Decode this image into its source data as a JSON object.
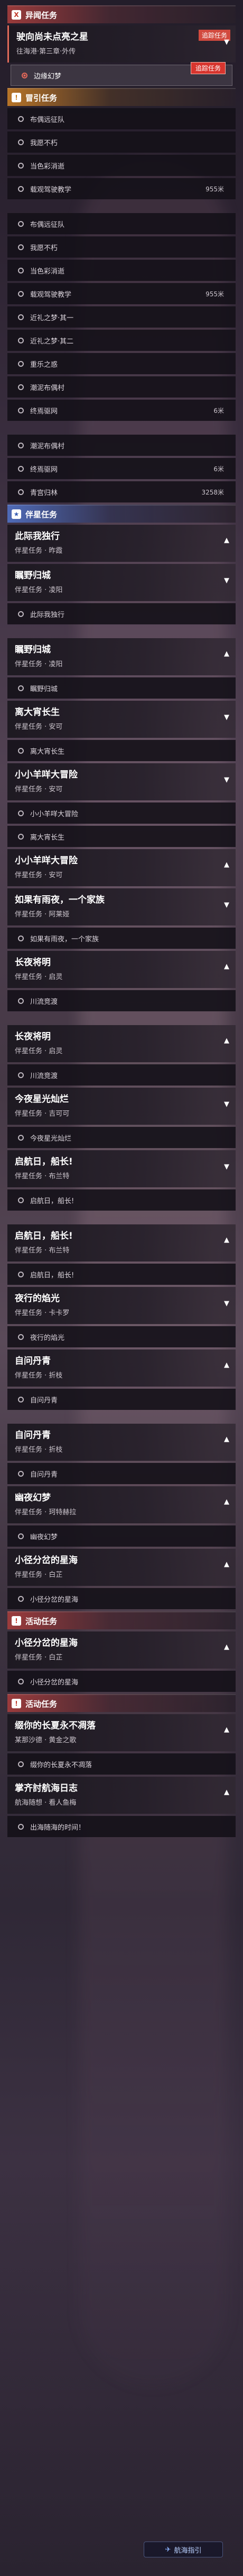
{
  "quest_list": {
    "sections": [
      {
        "kind": "trial",
        "title": "异闻任务",
        "icon": "X",
        "items": [
          {
            "type": "card",
            "title": "驶向尚未点亮之星",
            "sub": "往海港·第三章·外传",
            "arrow": "down",
            "active": true,
            "tag": "追踪任务"
          },
          {
            "type": "step",
            "text": "边缘幻梦",
            "active": true,
            "badge": "追踪任务"
          }
        ]
      },
      {
        "kind": "guide",
        "title": "冒引任务",
        "icon": "!",
        "items": [
          {
            "type": "step",
            "text": "布偶远征队"
          },
          {
            "type": "step",
            "text": "我愿不朽"
          },
          {
            "type": "step",
            "text": "当色彩消逝"
          },
          {
            "type": "step",
            "text": "载观驾驶教学",
            "dist": "955米"
          },
          {
            "type": "gap"
          },
          {
            "type": "step",
            "text": "布偶远征队"
          },
          {
            "type": "step",
            "text": "我愿不朽"
          },
          {
            "type": "step",
            "text": "当色彩消逝"
          },
          {
            "type": "step",
            "text": "载观驾驶教学",
            "dist": "955米"
          },
          {
            "type": "step",
            "text": "近礼之梦·其一"
          },
          {
            "type": "step",
            "text": "近礼之梦·其二"
          },
          {
            "type": "step",
            "text": "重乐之惑"
          },
          {
            "type": "step",
            "text": "潮泥布偶村"
          },
          {
            "type": "step",
            "text": "终焉驱网",
            "dist": "6米"
          },
          {
            "type": "gap"
          },
          {
            "type": "step",
            "text": "潮泥布偶村"
          },
          {
            "type": "step",
            "text": "终焉驱网",
            "dist": "6米"
          },
          {
            "type": "step",
            "text": "青宫归林",
            "dist": "3258米"
          }
        ]
      },
      {
        "kind": "comp",
        "title": "伴星任务",
        "icon": "★",
        "items": [
          {
            "type": "card",
            "title": "此际我独行",
            "sub": "伴星任务 · 昨霞",
            "arrow": "up"
          },
          {
            "type": "card",
            "title": "瞩野归城",
            "sub": "伴星任务 · 凌阳",
            "arrow": "down"
          },
          {
            "type": "step",
            "text": "此际我独行"
          },
          {
            "type": "gap"
          },
          {
            "type": "card",
            "title": "瞩野归城",
            "sub": "伴星任务 · 凌阳",
            "arrow": "up"
          },
          {
            "type": "step",
            "text": "瞩野归城"
          },
          {
            "type": "card",
            "title": "离大宵长生",
            "sub": "伴星任务 · 安可",
            "arrow": "down"
          },
          {
            "type": "step",
            "text": "离大宵长生"
          },
          {
            "type": "card",
            "title": "小小羊咩大冒险",
            "sub": "伴星任务 · 安可",
            "arrow": "down"
          },
          {
            "type": "step",
            "text": "小小羊咩大冒险"
          },
          {
            "type": "step",
            "text": "离大宵长生"
          },
          {
            "type": "card",
            "title": "小小羊咩大冒险",
            "sub": "伴星任务 · 安可",
            "arrow": "up"
          },
          {
            "type": "card",
            "title": "如果有雨夜，一个家族",
            "sub": "伴星任务 · 阿莱娅",
            "arrow": "down"
          },
          {
            "type": "step",
            "text": "如果有雨夜，一个家族"
          },
          {
            "type": "card",
            "title": "长夜将明",
            "sub": "伴星任务 · 启灵",
            "arrow": "up"
          },
          {
            "type": "step",
            "text": "川流竞渡"
          },
          {
            "type": "gap"
          },
          {
            "type": "card",
            "title": "长夜将明",
            "sub": "伴星任务 · 启灵",
            "arrow": "up"
          },
          {
            "type": "step",
            "text": "川流竞渡"
          },
          {
            "type": "card",
            "title": "今夜星光灿烂",
            "sub": "伴星任务 · 吉可可",
            "arrow": "down"
          },
          {
            "type": "step",
            "text": "今夜星光灿烂"
          },
          {
            "type": "card",
            "title": "启航日，船长!",
            "sub": "伴星任务 · 布兰特",
            "arrow": "down"
          },
          {
            "type": "step",
            "text": "启航日，船长!"
          },
          {
            "type": "gap"
          },
          {
            "type": "card",
            "title": "启航日，船长!",
            "sub": "伴星任务 · 布兰特",
            "arrow": "up"
          },
          {
            "type": "step",
            "text": "启航日，船长!"
          },
          {
            "type": "card",
            "title": "夜行的焰光",
            "sub": "伴星任务 · 卡卡罗",
            "arrow": "down"
          },
          {
            "type": "step",
            "text": "夜行的焰光"
          },
          {
            "type": "card",
            "title": "自问丹青",
            "sub": "伴星任务 · 折枝",
            "arrow": "up"
          },
          {
            "type": "step",
            "text": "自问丹青"
          },
          {
            "type": "gap"
          },
          {
            "type": "card",
            "title": "自问丹青",
            "sub": "伴星任务 · 折枝",
            "arrow": "up"
          },
          {
            "type": "step",
            "text": "自问丹青"
          },
          {
            "type": "card",
            "title": "幽夜幻梦",
            "sub": "伴星任务 · 珂特赫拉",
            "arrow": "up"
          },
          {
            "type": "step",
            "text": "幽夜幻梦"
          },
          {
            "type": "card",
            "title": "小径分岔的星海",
            "sub": "伴星任务 · 白芷",
            "arrow": "up"
          },
          {
            "type": "step",
            "text": "小径分岔的星海"
          }
        ]
      },
      {
        "kind": "trial",
        "title": "活动任务",
        "icon": "!",
        "items": [
          {
            "type": "card",
            "title": "小径分岔的星海",
            "sub": "伴星任务 · 白芷",
            "arrow": "up"
          },
          {
            "type": "step",
            "text": "小径分岔的星海"
          }
        ]
      },
      {
        "kind": "trial",
        "title": "活动任务",
        "icon": "!",
        "items": [
          {
            "type": "card",
            "title": "缀你的长夏永不凋落",
            "sub": "某那沙德 · 黄金之歌",
            "arrow": "up"
          },
          {
            "type": "step",
            "text": "缀你的长夏永不凋落"
          },
          {
            "type": "card",
            "title": "掌齐討航海日志",
            "sub": "航海随想 · 看人鱼梅",
            "arrow": "up"
          },
          {
            "type": "step",
            "text": "出海随海的时间！"
          }
        ]
      }
    ]
  },
  "nav_button": {
    "label": "航海指引",
    "icon": "compass-icon"
  }
}
